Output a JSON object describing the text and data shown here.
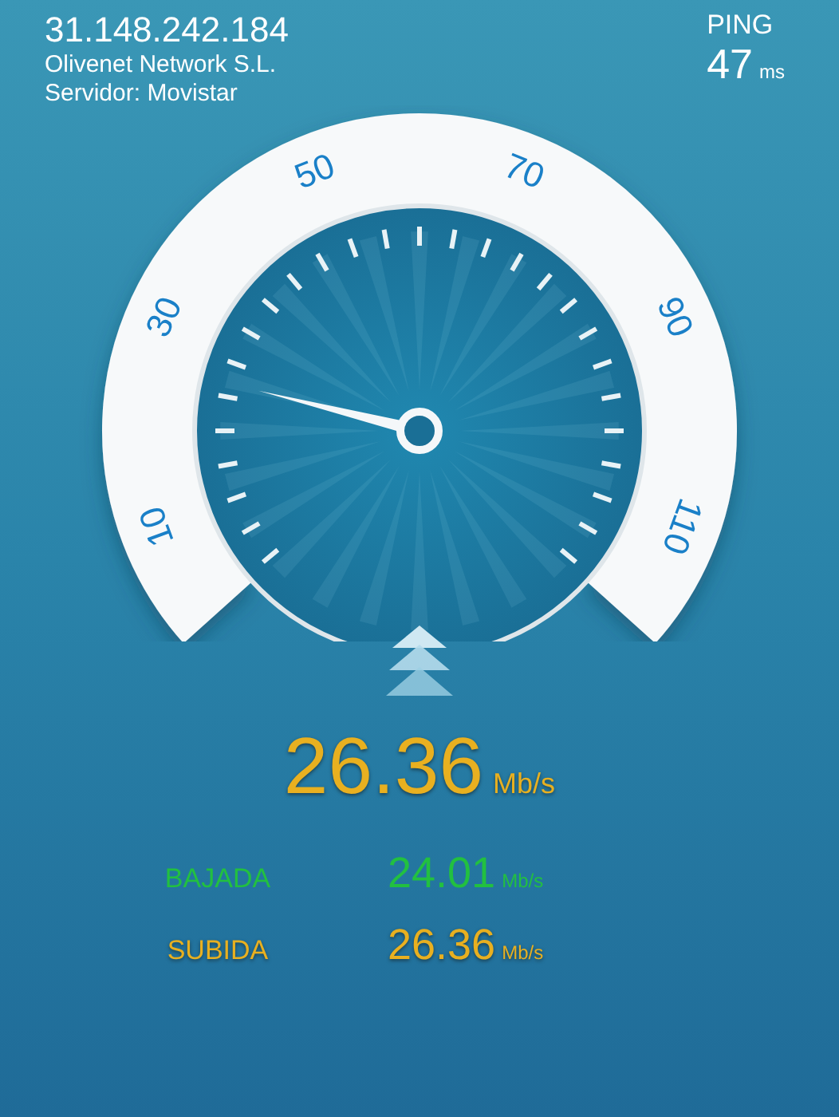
{
  "header": {
    "ip": "31.148.242.184",
    "isp": "Olivenet Network S.L.",
    "server": "Servidor: Movistar"
  },
  "ping": {
    "label": "PING",
    "value": "47",
    "unit": "ms"
  },
  "gauge": {
    "scale_labels": [
      "10",
      "30",
      "50",
      "70",
      "90",
      "110"
    ]
  },
  "speed": {
    "value": "26.36",
    "unit": "Mb/s"
  },
  "results": [
    {
      "kind": "download",
      "label": "BAJADA",
      "value": "24.01",
      "unit": "Mb/s",
      "color": "#22c040"
    },
    {
      "kind": "upload",
      "label": "SUBIDA",
      "value": "26.36",
      "unit": "Mb/s",
      "color": "#e8b020"
    }
  ]
}
